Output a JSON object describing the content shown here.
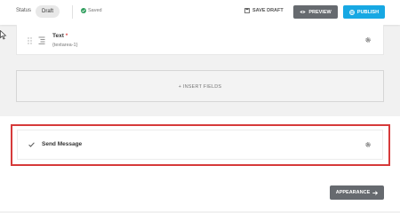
{
  "topbar": {
    "status_label": "Status",
    "status_value": "Draft",
    "saved_text": "Saved",
    "save_draft_label": "SAVE DRAFT",
    "preview_label": "PREVIEW",
    "publish_label": "PUBLISH"
  },
  "field": {
    "title": "Text",
    "required_mark": "*",
    "id": "{textarea-1}"
  },
  "insert": {
    "label": "+ INSERT FIELDS"
  },
  "send_message": {
    "label": "Send Message"
  },
  "footer": {
    "appearance_label": "APPEARANCE"
  },
  "colors": {
    "publish": "#17a8e3",
    "preview": "#666a6f",
    "saved": "#2e9d5c",
    "highlight": "#d63a3a",
    "required": "#e04b4b"
  },
  "icons": [
    "saved-check-icon",
    "save-draft-icon",
    "eye-icon",
    "globe-icon",
    "drag-handle-icon",
    "document-icon",
    "gear-icon",
    "checkmark-icon",
    "arrow-right-icon",
    "cursor-icon"
  ]
}
